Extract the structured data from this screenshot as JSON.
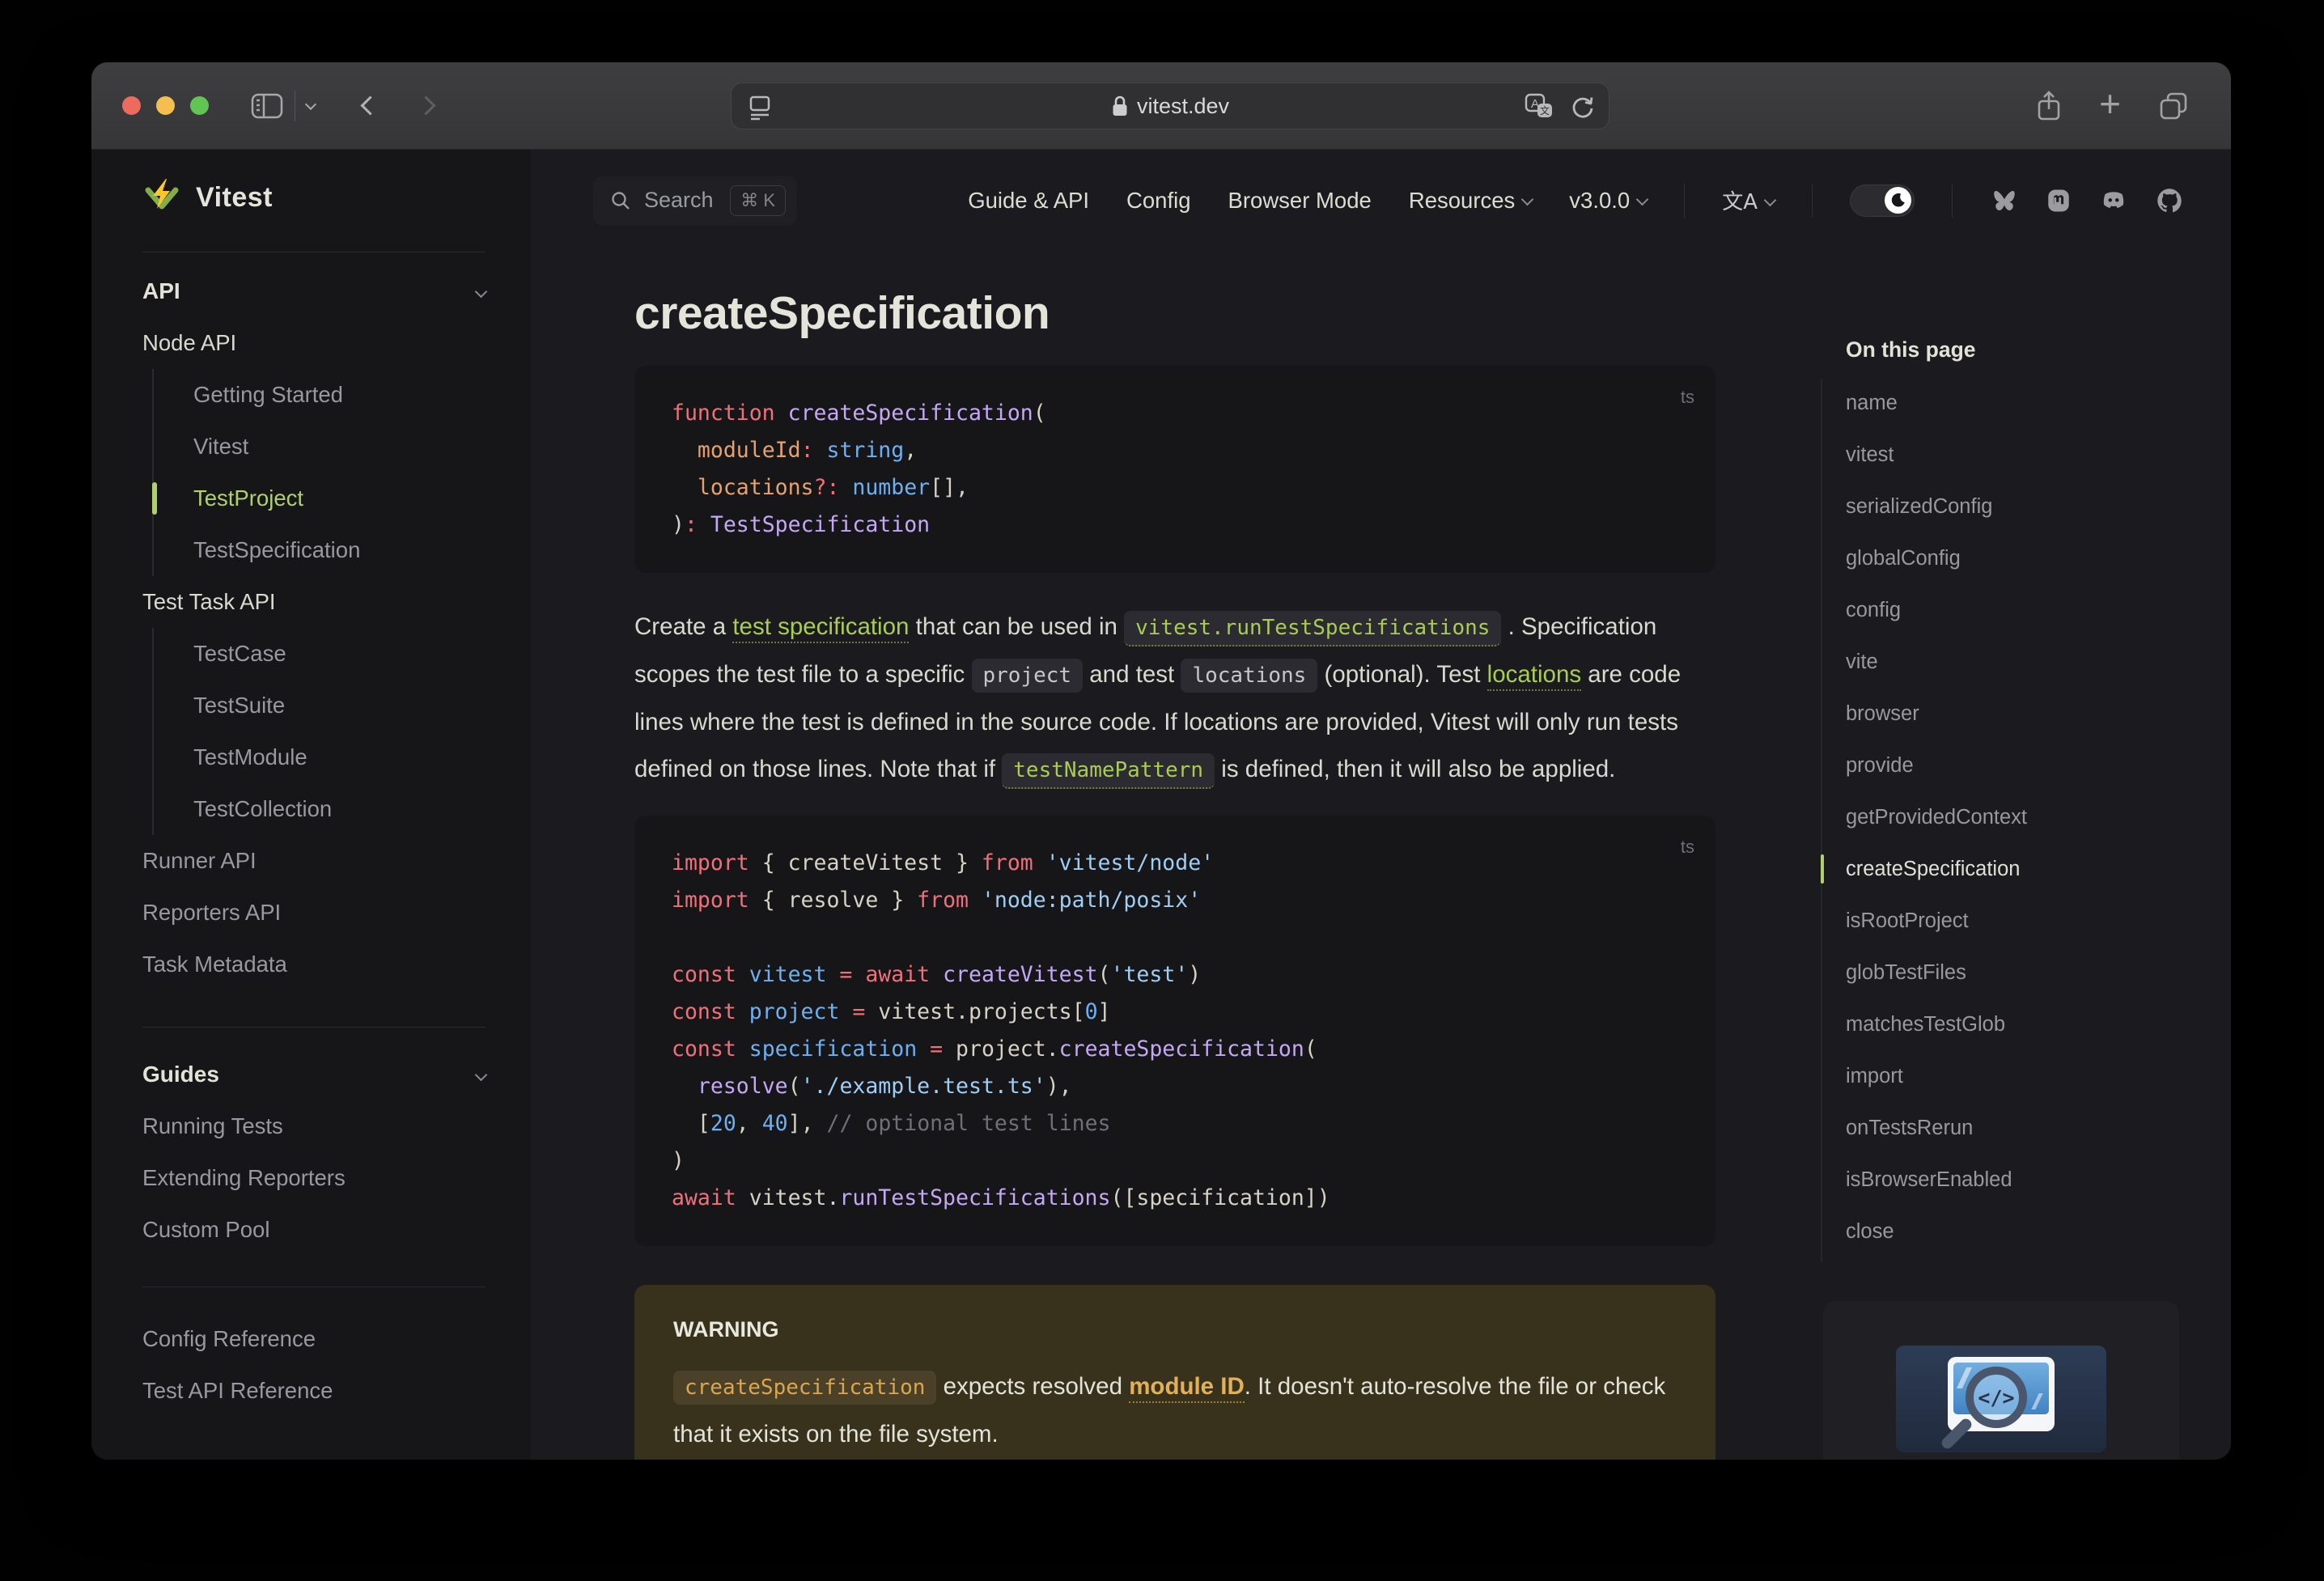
{
  "browser": {
    "url_host": "vitest.dev",
    "traffic_lights": {
      "close": "#ed6a5e",
      "minimize": "#f4bf4f",
      "zoom": "#61c554"
    }
  },
  "nav": {
    "search_label": "Search",
    "search_kbd": "⌘ K",
    "links": [
      {
        "label": "Guide & API",
        "chevron": false
      },
      {
        "label": "Config",
        "chevron": false
      },
      {
        "label": "Browser Mode",
        "chevron": false
      },
      {
        "label": "Resources",
        "chevron": true
      },
      {
        "label": "v3.0.0",
        "chevron": true
      }
    ],
    "translate_glyph": "文A"
  },
  "sidebar": {
    "brand": "Vitest",
    "section_api": "API",
    "node_api_label": "Node API",
    "node_api_items": [
      {
        "label": "Getting Started"
      },
      {
        "label": "Vitest"
      },
      {
        "label": "TestProject",
        "active": true
      },
      {
        "label": "TestSpecification"
      }
    ],
    "task_api_label": "Test Task API",
    "task_api_items": [
      {
        "label": "TestCase"
      },
      {
        "label": "TestSuite"
      },
      {
        "label": "TestModule"
      },
      {
        "label": "TestCollection"
      }
    ],
    "api_links": [
      {
        "label": "Runner API"
      },
      {
        "label": "Reporters API"
      },
      {
        "label": "Task Metadata"
      }
    ],
    "section_guides": "Guides",
    "guides_links": [
      {
        "label": "Running Tests"
      },
      {
        "label": "Extending Reporters"
      },
      {
        "label": "Custom Pool"
      }
    ],
    "bottom_links": [
      {
        "label": "Config Reference"
      },
      {
        "label": "Test API Reference"
      }
    ]
  },
  "article": {
    "title": "createSpecification",
    "code1_lang": "ts",
    "code1": [
      [
        [
          "r",
          "function"
        ],
        [
          "w",
          " "
        ],
        [
          "p",
          "createSpecification"
        ],
        [
          "w",
          "("
        ]
      ],
      [
        [
          "w",
          "  "
        ],
        [
          "o",
          "moduleId"
        ],
        [
          "r",
          ":"
        ],
        [
          "b",
          " string"
        ],
        [
          "w",
          ","
        ]
      ],
      [
        [
          "w",
          "  "
        ],
        [
          "o",
          "locations"
        ],
        [
          "r",
          "?:"
        ],
        [
          "b",
          " number"
        ],
        [
          "w",
          "[],"
        ]
      ],
      [
        [
          "w",
          ")"
        ],
        [
          "r",
          ":"
        ],
        [
          "p",
          " TestSpecification"
        ]
      ]
    ],
    "paragraph": [
      {
        "t": "Create a ",
        "s": "plain"
      },
      {
        "t": "test specification",
        "s": "link"
      },
      {
        "t": " that can be used in ",
        "s": "plain"
      },
      {
        "t": "vitest.runTestSpecifications",
        "s": "chiplink"
      },
      {
        "t": " . Specification scopes the test file to a specific ",
        "s": "plain"
      },
      {
        "t": "project",
        "s": "chip"
      },
      {
        "t": " and test ",
        "s": "plain"
      },
      {
        "t": "locations",
        "s": "chip"
      },
      {
        "t": " (optional). Test ",
        "s": "plain"
      },
      {
        "t": "locations",
        "s": "link"
      },
      {
        "t": " are code lines where the test is defined in the source code. If locations are provided, Vitest will only run tests defined on those lines. Note that if ",
        "s": "plain"
      },
      {
        "t": "testNamePattern",
        "s": "chiplink"
      },
      {
        "t": " is defined, then it will also be applied.",
        "s": "plain"
      }
    ],
    "code2_lang": "ts",
    "code2": [
      [
        [
          "r",
          "import"
        ],
        [
          "w",
          " { createVitest } "
        ],
        [
          "r",
          "from"
        ],
        [
          "s",
          " 'vitest/node'"
        ]
      ],
      [
        [
          "r",
          "import"
        ],
        [
          "w",
          " { resolve } "
        ],
        [
          "r",
          "from"
        ],
        [
          "s",
          " 'node:path/posix'"
        ]
      ],
      [],
      [
        [
          "r",
          "const"
        ],
        [
          "b",
          " vitest"
        ],
        [
          "r",
          " ="
        ],
        [
          "r",
          " await"
        ],
        [
          "p",
          " createVitest"
        ],
        [
          "w",
          "("
        ],
        [
          "s",
          "'test'"
        ],
        [
          "w",
          ")"
        ]
      ],
      [
        [
          "r",
          "const"
        ],
        [
          "b",
          " project"
        ],
        [
          "r",
          " ="
        ],
        [
          "w",
          " vitest.projects["
        ],
        [
          "b",
          "0"
        ],
        [
          "w",
          "]"
        ]
      ],
      [
        [
          "r",
          "const"
        ],
        [
          "b",
          " specification"
        ],
        [
          "r",
          " ="
        ],
        [
          "w",
          " project."
        ],
        [
          "p",
          "createSpecification"
        ],
        [
          "w",
          "("
        ]
      ],
      [
        [
          "w",
          "  "
        ],
        [
          "p",
          "resolve"
        ],
        [
          "w",
          "("
        ],
        [
          "s",
          "'./example.test.ts'"
        ],
        [
          "w",
          "),"
        ]
      ],
      [
        [
          "w",
          "  ["
        ],
        [
          "b",
          "20"
        ],
        [
          "w",
          ", "
        ],
        [
          "b",
          "40"
        ],
        [
          "w",
          "], "
        ],
        [
          "g",
          "// optional test lines"
        ]
      ],
      [
        [
          "w",
          ")"
        ]
      ],
      [
        [
          "r",
          "await"
        ],
        [
          "w",
          " vitest."
        ],
        [
          "p",
          "runTestSpecifications"
        ],
        [
          "w",
          "([specification])"
        ]
      ]
    ],
    "warning_title": "WARNING",
    "warning_body": [
      {
        "t": "createSpecification",
        "s": "wchip"
      },
      {
        "t": " expects resolved ",
        "s": "plain"
      },
      {
        "t": "module ID",
        "s": "wlink"
      },
      {
        "t": ". It doesn't auto-resolve the file or check that it exists on the file system.",
        "s": "plain"
      }
    ]
  },
  "toc": {
    "title": "On this page",
    "items": [
      {
        "label": "name"
      },
      {
        "label": "vitest"
      },
      {
        "label": "serializedConfig"
      },
      {
        "label": "globalConfig"
      },
      {
        "label": "config"
      },
      {
        "label": "vite"
      },
      {
        "label": "browser"
      },
      {
        "label": "provide"
      },
      {
        "label": "getProvidedContext"
      },
      {
        "label": "createSpecification",
        "active": true
      },
      {
        "label": "isRootProject"
      },
      {
        "label": "globTestFiles"
      },
      {
        "label": "matchesTestGlob"
      },
      {
        "label": "import"
      },
      {
        "label": "onTestsRerun"
      },
      {
        "label": "isBrowserEnabled"
      },
      {
        "label": "close"
      }
    ]
  },
  "ad": {
    "glyph": "</>"
  },
  "colors": {
    "accent_green": "#aed06e",
    "link_green": "#a9cc54",
    "warning_orange": "#e3b05a",
    "page_bg": "#1b1b1f",
    "sidebar_bg": "#161618",
    "code_bg": "#161618"
  }
}
